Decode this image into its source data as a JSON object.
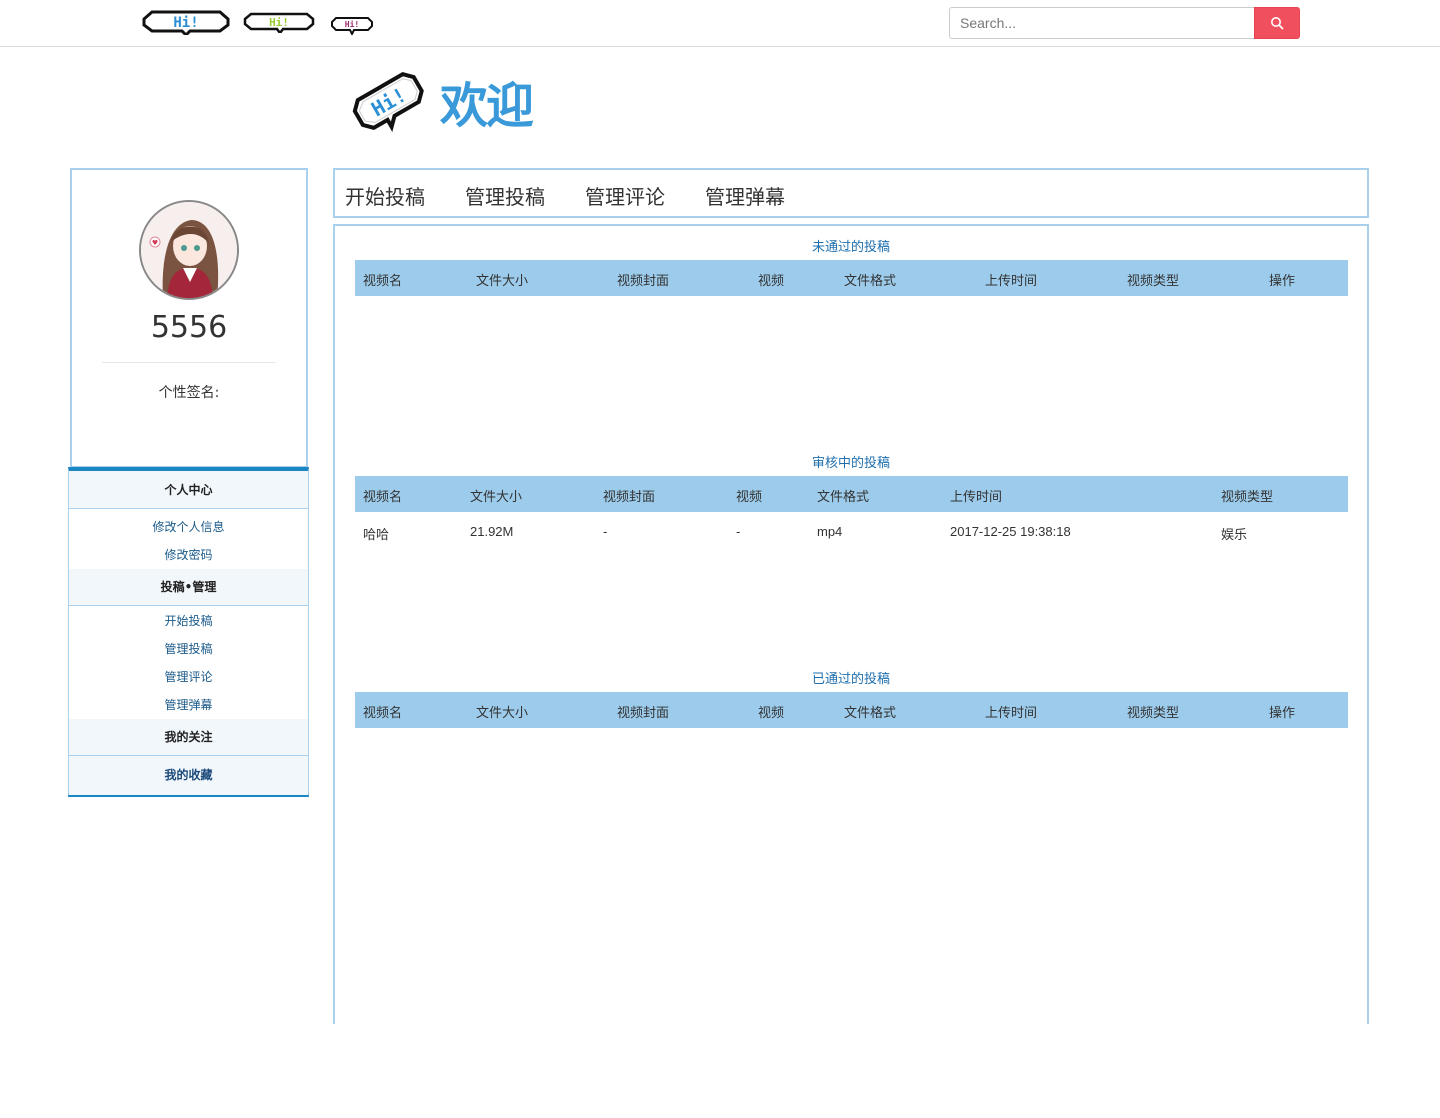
{
  "search": {
    "placeholder": "Search..."
  },
  "banner": {
    "title": "欢迎"
  },
  "profile": {
    "username": "5556",
    "signature_label": "个性签名:"
  },
  "sidebar": {
    "group_personal": "个人中心",
    "edit_info": "修改个人信息",
    "change_password": "修改密码",
    "group_submissions": "投稿•管理",
    "start_submit": "开始投稿",
    "manage_submissions": "管理投稿",
    "manage_comments": "管理评论",
    "manage_danmaku": "管理弹幕",
    "my_follows": "我的关注",
    "my_favorites": "我的收藏"
  },
  "tabs": [
    "开始投稿",
    "管理投稿",
    "管理评论",
    "管理弹幕"
  ],
  "sections": {
    "rejected": {
      "title": "未通过的投稿",
      "columns": [
        "视频名",
        "文件大小",
        "视频封面",
        "视频",
        "文件格式",
        "上传时间",
        "视频类型",
        "操作"
      ]
    },
    "pending": {
      "title": "审核中的投稿",
      "columns": [
        "视频名",
        "文件大小",
        "视频封面",
        "视频",
        "文件格式",
        "上传时间",
        "视频类型"
      ],
      "rows": [
        [
          "哈哈",
          "21.92M",
          "-",
          "-",
          "mp4",
          "2017-12-25 19:38:18",
          "娱乐"
        ]
      ]
    },
    "approved": {
      "title": "已通过的投稿",
      "columns": [
        "视频名",
        "文件大小",
        "视频封面",
        "视频",
        "文件格式",
        "上传时间",
        "视频类型",
        "操作"
      ]
    }
  },
  "colors": {
    "accent": "#3a9ad9",
    "search_button": "#f0505d",
    "table_header": "#9ccbeb",
    "border": "#a9d0ec",
    "menu_bar": "#1b86c4"
  }
}
